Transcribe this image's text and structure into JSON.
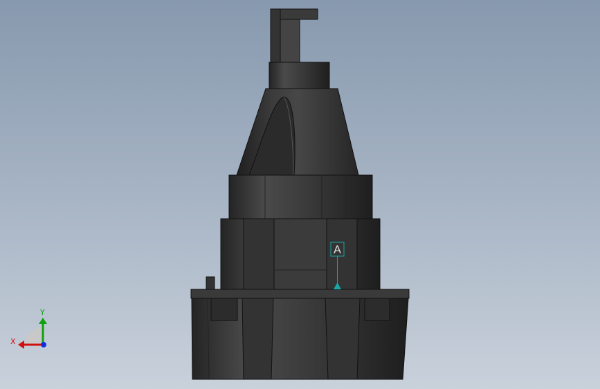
{
  "viewport": {
    "background_top": "#8799ae",
    "background_bottom": "#c9d1db"
  },
  "model": {
    "part_color": "#3a3a3a",
    "edge_color": "#111111"
  },
  "datum": {
    "label": "A",
    "color": "#1aa6a6"
  },
  "triad": {
    "x_label": "X",
    "y_label": "Y",
    "x_color": "#d01010",
    "y_color": "#10a010",
    "z_color": "#1030e0"
  }
}
